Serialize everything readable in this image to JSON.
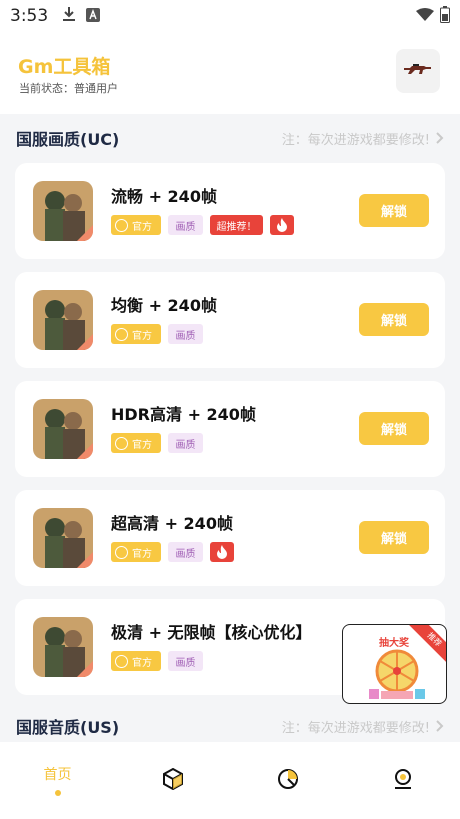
{
  "status_bar": {
    "time": "3:53",
    "icons": [
      "download-icon",
      "app-a-icon",
      "wifi-icon",
      "battery-icon"
    ]
  },
  "header": {
    "title": "Gm工具箱",
    "status": "当前状态：普通用户",
    "action_icon": "rifle-icon"
  },
  "section_uc": {
    "title": "国服画质(UC)",
    "note": "注：每次进游戏都要修改!"
  },
  "cards": [
    {
      "title": "流畅 + 240帧",
      "tags": {
        "official": "官方",
        "quality": "画质",
        "recommend": "超推荐！",
        "fire": true
      },
      "button": "解锁"
    },
    {
      "title": "均衡 + 240帧",
      "tags": {
        "official": "官方",
        "quality": "画质"
      },
      "button": "解锁"
    },
    {
      "title": "HDR高清 + 240帧",
      "tags": {
        "official": "官方",
        "quality": "画质"
      },
      "button": "解锁"
    },
    {
      "title": "超高清 + 240帧",
      "tags": {
        "official": "官方",
        "quality": "画质",
        "fire": true
      },
      "button": "解锁"
    },
    {
      "title": "极清 + 无限帧【核心优化】",
      "tags": {
        "official": "官方",
        "quality": "画质"
      },
      "button": "解锁"
    }
  ],
  "section_us": {
    "title": "国服音质(US)",
    "note": "注：每次进游戏都要修改!"
  },
  "promo": {
    "title": "抽大奖",
    "ribbon": "推荐"
  },
  "bottom_nav": {
    "home_label": "首页",
    "items": [
      "home",
      "cube-icon",
      "pie-chart-icon",
      "profile-icon"
    ]
  },
  "colors": {
    "accent": "#f5c33b",
    "button": "#f8c842",
    "red": "#e8433a",
    "quality_bg": "#f3e6f7",
    "quality_text": "#a05fb5"
  }
}
